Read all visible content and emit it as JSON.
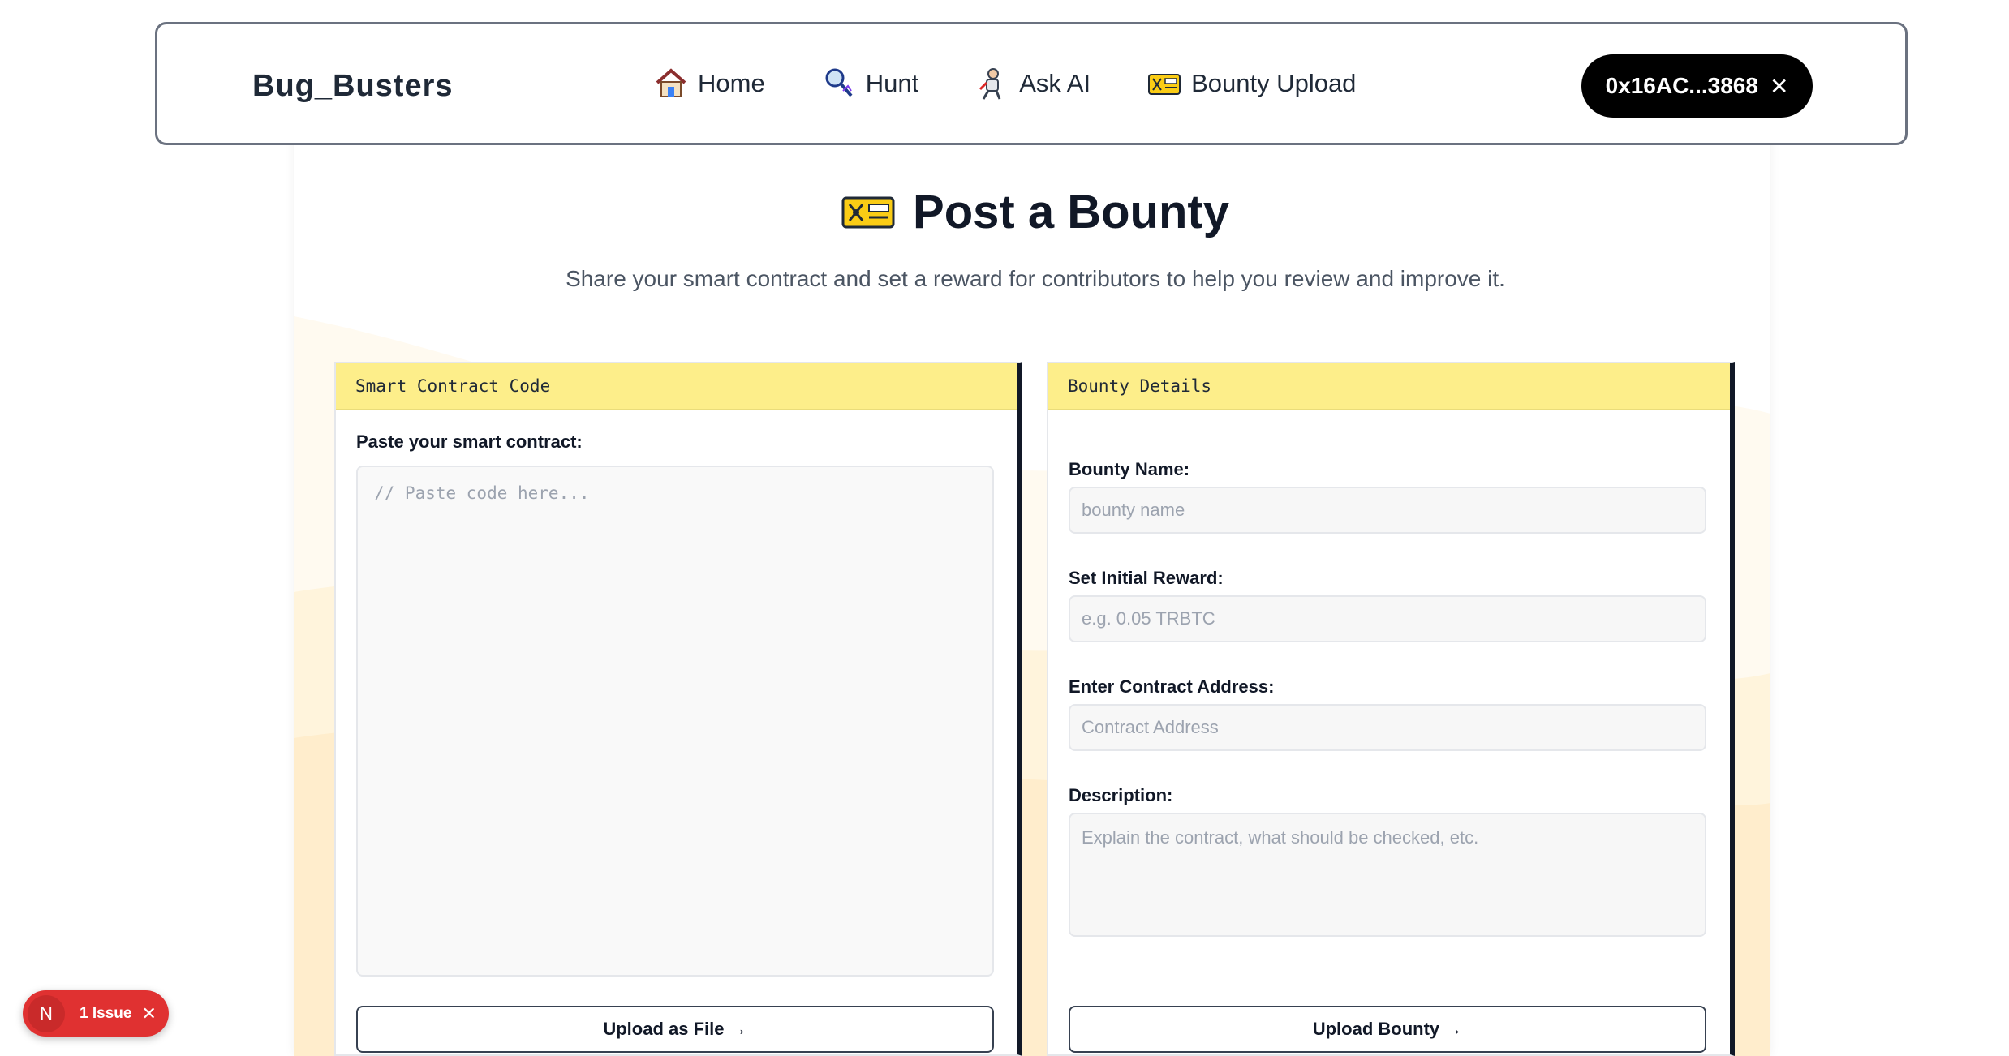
{
  "navbar": {
    "brand": "Bug_Busters",
    "links": [
      {
        "label": "Home",
        "icon": "house-icon"
      },
      {
        "label": "Hunt",
        "icon": "magnifier-icon"
      },
      {
        "label": "Ask AI",
        "icon": "robot-icon"
      },
      {
        "label": "Bounty Upload",
        "icon": "bounty-card-icon"
      }
    ],
    "wallet": {
      "address": "0x16AC...3868",
      "close_glyph": "✕"
    }
  },
  "header": {
    "title": "Post a Bounty",
    "subtitle": "Share your smart contract and set a reward for contributors to help you review and improve it."
  },
  "left_panel": {
    "heading": "Smart Contract Code",
    "code_label": "Paste your smart contract:",
    "code_placeholder": "// Paste code here...",
    "upload_button": "Upload as File →"
  },
  "right_panel": {
    "heading": "Bounty Details",
    "fields": [
      {
        "label": "Bounty Name:",
        "placeholder": "bounty name"
      },
      {
        "label": "Set Initial Reward:",
        "placeholder": "e.g. 0.05 TRBTC"
      },
      {
        "label": "Enter Contract Address:",
        "placeholder": "Contract Address"
      },
      {
        "label": "Description:",
        "placeholder": "Explain the contract, what should be checked, etc."
      }
    ],
    "upload_button": "Upload Bounty →"
  },
  "issue_badge": {
    "initial": "N",
    "text": "1 Issue",
    "close_glyph": "✕"
  },
  "colors": {
    "panel_header": "#fdee8a",
    "wallet_bg": "#000000",
    "issue_red": "#e03131",
    "background_wave": "#fff4dc"
  }
}
